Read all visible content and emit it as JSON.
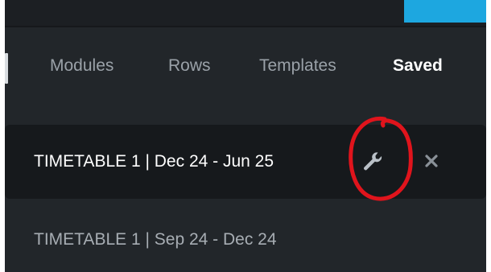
{
  "topbar": {
    "accent_color": "#1da7e0"
  },
  "tabs": [
    {
      "label": "Modules",
      "active": false
    },
    {
      "label": "Rows",
      "active": false
    },
    {
      "label": "Templates",
      "active": false
    },
    {
      "label": "Saved",
      "active": true
    }
  ],
  "saved_items": [
    {
      "label": "TIMETABLE 1 | Dec 24 - Jun 25",
      "selected": true,
      "actions": [
        "wrench-icon",
        "close-icon"
      ]
    },
    {
      "label": "TIMETABLE 1 | Sep 24 - Dec 24",
      "selected": false
    }
  ],
  "annotation": {
    "shape": "hand-drawn circle",
    "color": "#e0141c",
    "target": "wrench-icon"
  }
}
